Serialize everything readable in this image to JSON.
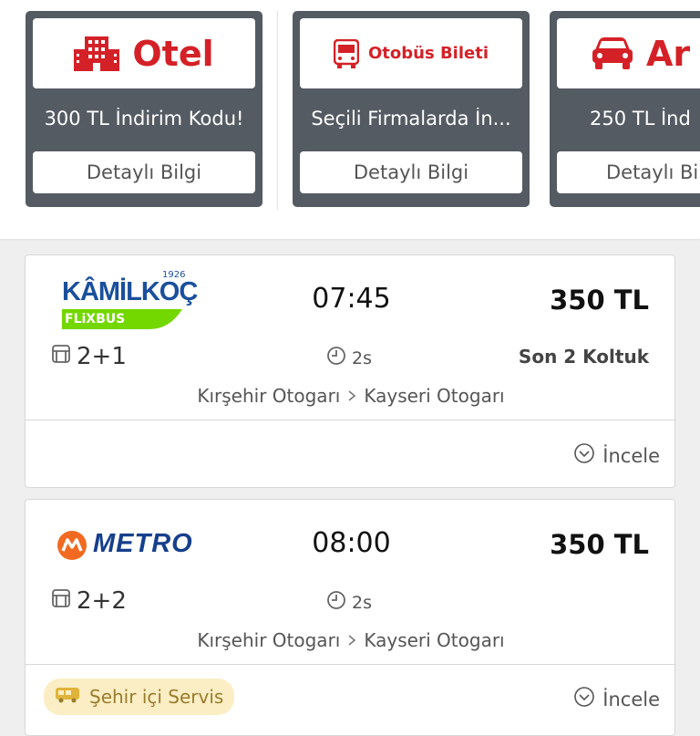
{
  "promos": [
    {
      "title": "Otel",
      "icon": "hotel-building-icon",
      "text": "300 TL İndirim Kodu!",
      "button": "Detaylı Bilgi"
    },
    {
      "title": "Otobüs Bileti",
      "icon": "bus-icon",
      "text": "Seçili Firmalarda İn...",
      "button": "Detaylı Bilgi"
    },
    {
      "title": "Ar",
      "icon": "car-icon",
      "text": "250 TL İnd",
      "button": "Detaylı Bi"
    }
  ],
  "trips": [
    {
      "company": {
        "name": "KÂMİLKOÇ",
        "year": "1926",
        "sub": "FLiXBUS"
      },
      "time": "07:45",
      "price": "350 TL",
      "seat_layout": "2+1",
      "duration": "2s",
      "seats_left": "Son 2 Koltuk",
      "from": "Kırşehir Otogarı",
      "to": "Kayseri Otogarı",
      "review": "İncele"
    },
    {
      "company": {
        "name": "METRO"
      },
      "time": "08:00",
      "price": "350 TL",
      "seat_layout": "2+2",
      "duration": "2s",
      "from": "Kırşehir Otogarı",
      "to": "Kayseri Otogarı",
      "badge": "Şehir içi Servis",
      "review": "İncele"
    }
  ],
  "colors": {
    "brand_red": "#d42127",
    "promo_bg": "#545b62",
    "kamilkoc_blue": "#1a4f9c",
    "flixbus_green": "#73d700",
    "metro_orange": "#f26a21"
  }
}
